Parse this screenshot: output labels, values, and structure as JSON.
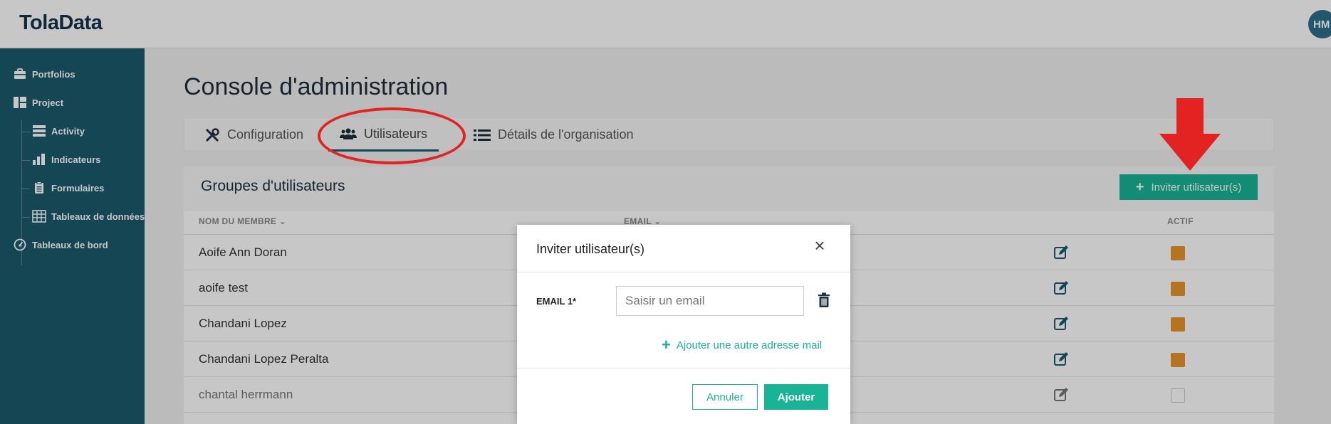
{
  "app": {
    "logo": "TolaData",
    "user_initials": "HM"
  },
  "sidebar": {
    "items": [
      {
        "label": "Portfolios",
        "icon": "briefcase-icon"
      },
      {
        "label": "Project",
        "icon": "dashboard-grid-icon"
      },
      {
        "label": "Activity",
        "icon": "server-stack-icon"
      },
      {
        "label": "Indicateurs",
        "icon": "bar-chart-icon"
      },
      {
        "label": "Formulaires",
        "icon": "clipboard-icon"
      },
      {
        "label": "Tableaux de données",
        "icon": "table-icon"
      },
      {
        "label": "Tableaux de bord",
        "icon": "gauge-icon"
      }
    ]
  },
  "main": {
    "title": "Console d'administration",
    "tabs": [
      {
        "label": "Configuration",
        "icon": "tools-icon"
      },
      {
        "label": "Utilisateurs",
        "icon": "users-icon",
        "active": true
      },
      {
        "label": "Détails de l'organisation",
        "icon": "list-icon"
      }
    ],
    "panel": {
      "title": "Groupes d'utilisateurs",
      "invite_button": "Inviter utilisateur(s)",
      "columns": {
        "name": "NOM DU MEMBRE",
        "email": "EMAIL",
        "active": "ACTIF"
      },
      "rows": [
        {
          "name": "Aoife Ann Doran",
          "active": true
        },
        {
          "name": "aoife test",
          "active": true
        },
        {
          "name": "Chandani Lopez",
          "active": true
        },
        {
          "name": "Chandani Lopez Peralta",
          "active": true
        },
        {
          "name": "chantal herrmann",
          "active": false
        }
      ]
    }
  },
  "modal": {
    "title": "Inviter utilisateur(s)",
    "email_label": "EMAIL 1*",
    "email_placeholder": "Saisir un email",
    "add_more": "Ajouter une autre adresse mail",
    "cancel": "Annuler",
    "submit": "Ajouter"
  },
  "colors": {
    "sidebar": "#1a5a6c",
    "accent": "#18b495",
    "checkbox": "#e8962a",
    "annotation": "#e32222"
  }
}
